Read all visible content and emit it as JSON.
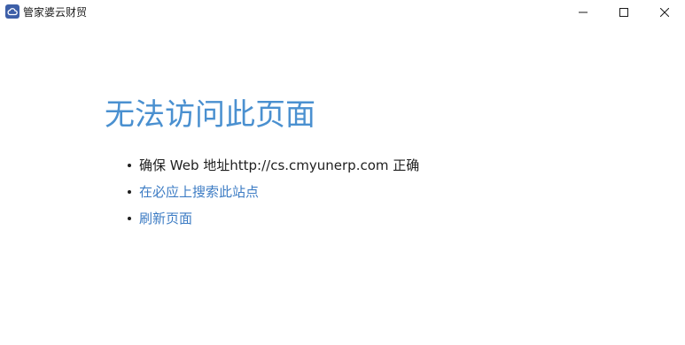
{
  "window": {
    "title": "管家婆云财贸",
    "controls": {
      "minimize_icon": "minimize-icon",
      "maximize_icon": "maximize-icon",
      "close_icon": "close-icon"
    }
  },
  "error_page": {
    "heading": "无法访问此页面",
    "items": [
      {
        "text": "确保 Web 地址http://cs.cmyunerp.com 正确",
        "type": "text"
      },
      {
        "text": "在必应上搜索此站点",
        "type": "link"
      },
      {
        "text": "刷新页面",
        "type": "link"
      }
    ]
  },
  "colors": {
    "heading": "#4a90d0",
    "link": "#3d7cc4",
    "app_icon_bg": "#3d5fa8"
  }
}
